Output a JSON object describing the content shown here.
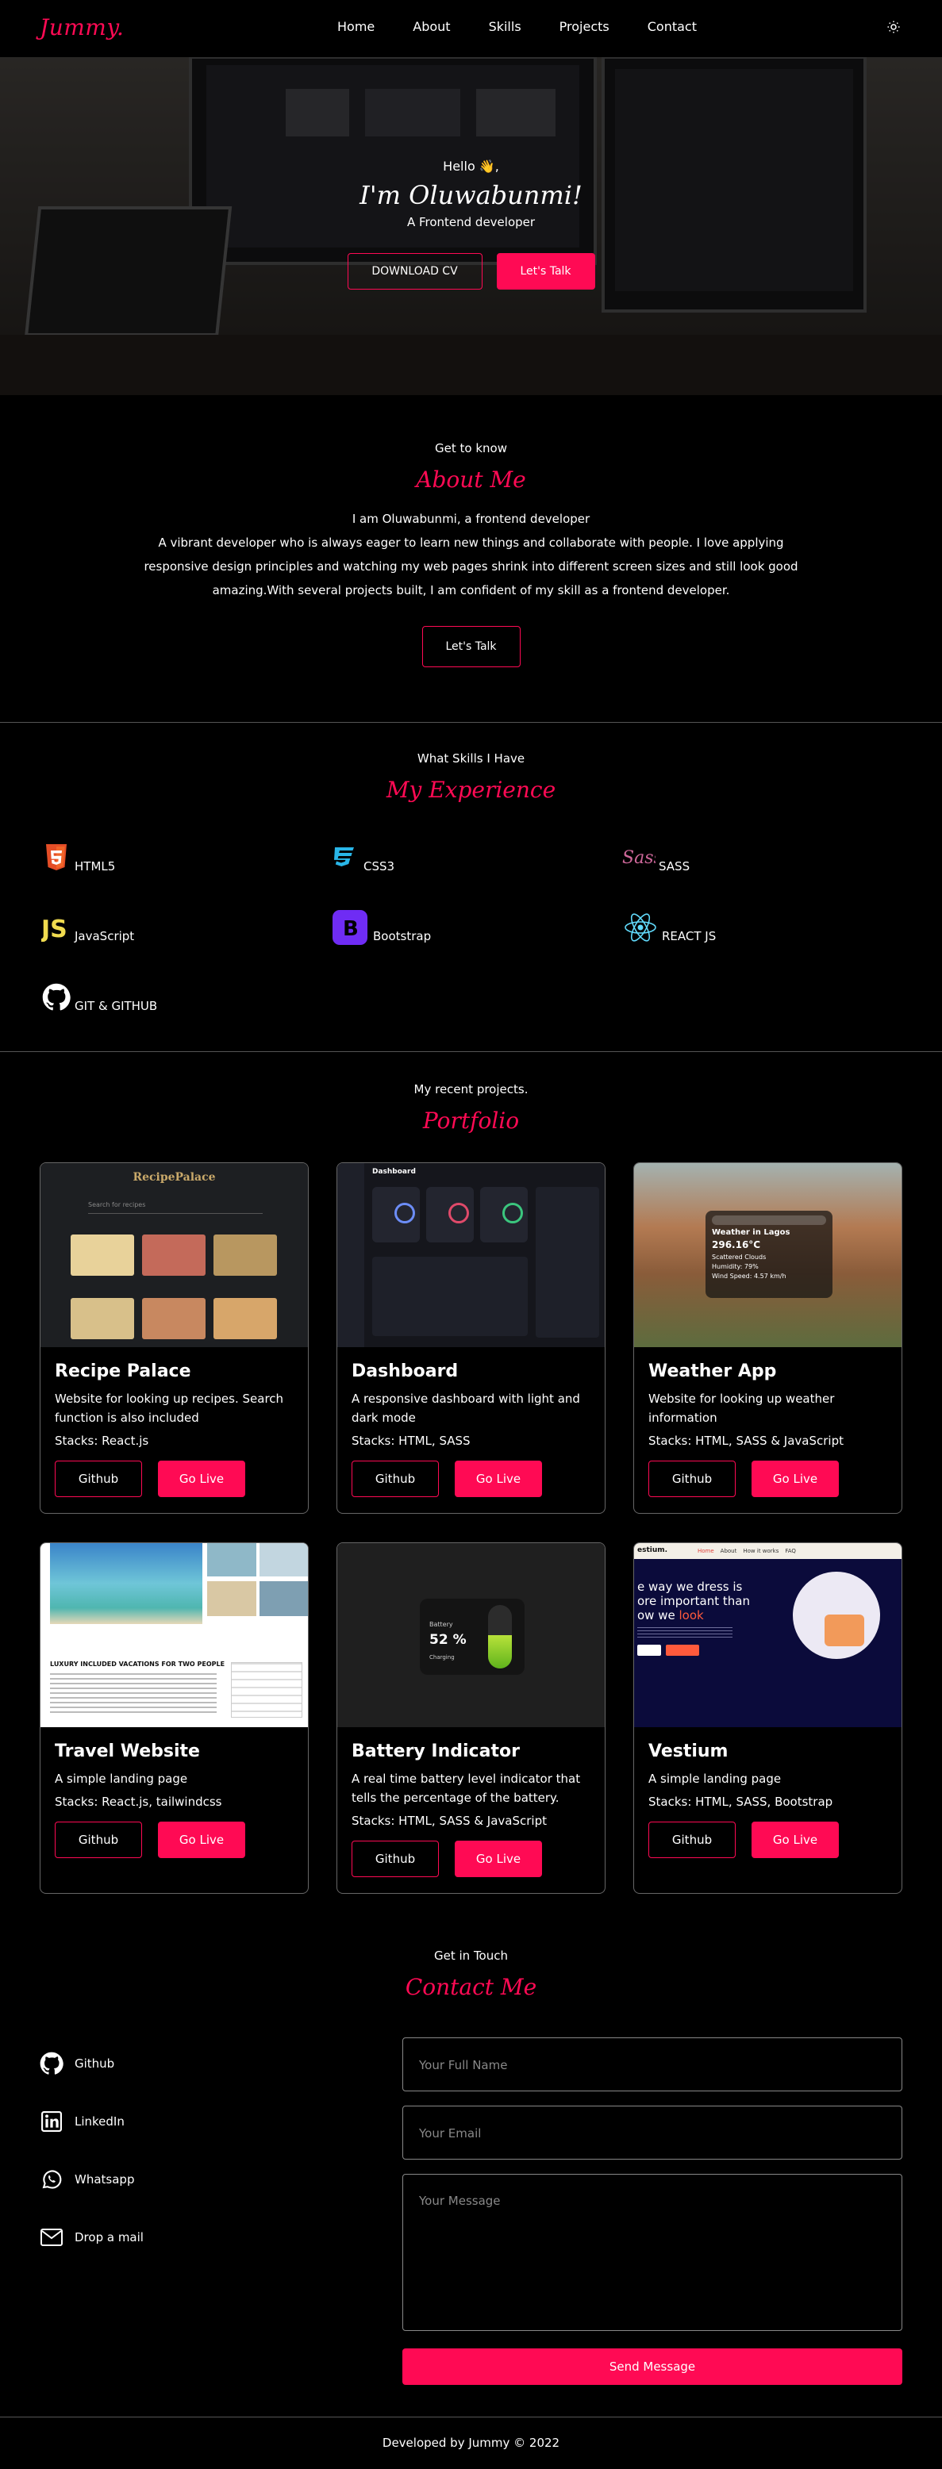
{
  "nav": {
    "logo": "Jummy.",
    "links": [
      "Home",
      "About",
      "Skills",
      "Projects",
      "Contact"
    ],
    "theme_icon": "sun-icon"
  },
  "hero": {
    "hello": "Hello 👋,",
    "name": "I'm Oluwabunmi!",
    "role": "A Frontend developer",
    "download_label": "DOWNLOAD CV",
    "talk_label": "Let's Talk"
  },
  "about": {
    "subtitle": "Get to know",
    "title": "About Me",
    "intro": "I am Oluwabunmi, a frontend developer",
    "text": "A vibrant developer who is always eager to learn new things and collaborate with people. I love applying responsive design principles and watching my web pages shrink into different screen sizes and still look good amazing.With several projects built, I am confident of my skill as a frontend developer.",
    "button": "Let's Talk"
  },
  "skills": {
    "subtitle": "What Skills I Have",
    "title": "My Experience",
    "items": [
      {
        "label": "HTML5",
        "icon": "html5-icon"
      },
      {
        "label": "CSS3",
        "icon": "css3-icon"
      },
      {
        "label": "SASS",
        "icon": "sass-icon"
      },
      {
        "label": "JavaScript",
        "icon": "javascript-icon"
      },
      {
        "label": "Bootstrap",
        "icon": "bootstrap-icon"
      },
      {
        "label": "REACT JS",
        "icon": "react-icon"
      },
      {
        "label": "GIT & GITHUB",
        "icon": "github-icon"
      }
    ]
  },
  "projects": {
    "subtitle": "My recent projects.",
    "title": "Portfolio",
    "github_label": "Github",
    "live_label": "Go Live",
    "items": [
      {
        "title": "Recipe Palace",
        "desc": "Website for looking up recipes. Search function is also included",
        "stack": "Stacks: React.js"
      },
      {
        "title": "Dashboard",
        "desc": "A responsive dashboard with light and dark mode",
        "stack": "Stacks: HTML, SASS"
      },
      {
        "title": "Weather App",
        "desc": "Website for looking up weather information",
        "stack": "Stacks: HTML, SASS & JavaScript"
      },
      {
        "title": "Travel Website",
        "desc": "A simple landing page",
        "stack": "Stacks: React.js, tailwindcss"
      },
      {
        "title": "Battery Indicator",
        "desc": "A real time battery level indicator that tells the percentage of the battery.",
        "stack": "Stacks: HTML, SASS & JavaScript"
      },
      {
        "title": "Vestium",
        "desc": "A simple landing page",
        "stack": "Stacks: HTML, SASS, Bootstrap"
      }
    ],
    "thumbs": {
      "recipe_title": "RecipePalace",
      "recipe_search": "Search for recipes",
      "dashboard_title": "Dashboard",
      "weather_city": "Weather in Lagos",
      "weather_temp": "296.16°C",
      "weather_desc": "Scattered Clouds",
      "weather_humidity": "Humidity: 79%",
      "weather_wind": "Wind Speed: 4.57 km/h",
      "travel_headline": "LUXURY INCLUDED VACATIONS FOR TWO PEOPLE",
      "battery_label": "Battery",
      "battery_value": "52 %",
      "battery_status": "Charging",
      "vestium_brand": "estium.",
      "vestium_nav": [
        "Home",
        "About",
        "How it works",
        "FAQ"
      ],
      "vestium_headline_1": "e way we dress is",
      "vestium_headline_2": "ore important than",
      "vestium_headline_3": "ow we",
      "vestium_headline_accent": "look"
    }
  },
  "contact": {
    "subtitle": "Get in Touch",
    "title": "Contact Me",
    "links": [
      {
        "label": "Github",
        "icon": "github-icon"
      },
      {
        "label": "LinkedIn",
        "icon": "linkedin-icon"
      },
      {
        "label": "Whatsapp",
        "icon": "whatsapp-icon"
      },
      {
        "label": "Drop a mail",
        "icon": "mail-icon"
      }
    ],
    "name_placeholder": "Your Full Name",
    "email_placeholder": "Your Email",
    "message_placeholder": "Your Message",
    "send_label": "Send Message"
  },
  "footer": {
    "text": "Developed by Jummy © 2022"
  },
  "colors": {
    "accent": "#ff0a54",
    "background": "#000000"
  }
}
